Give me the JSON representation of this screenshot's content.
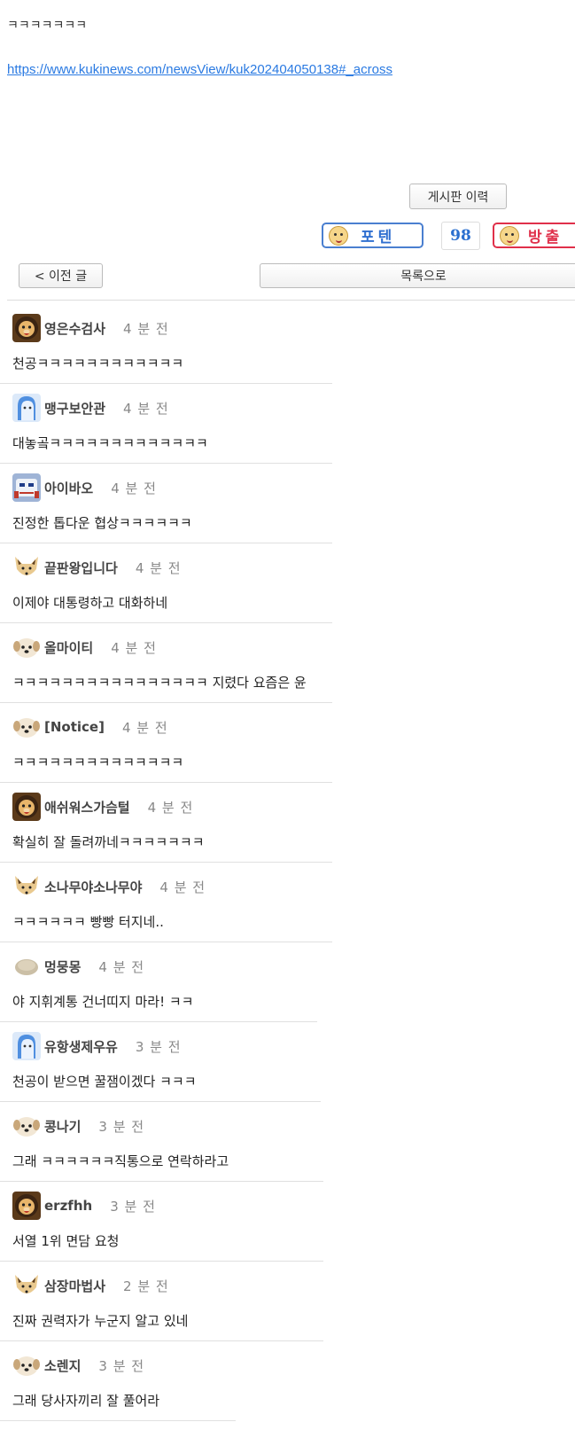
{
  "post": {
    "text": "ㅋㅋㅋㅋㅋㅋㅋ",
    "link": "https://www.kukinews.com/newsView/kuk202404050138#_across"
  },
  "actions": {
    "history_label": "게시판 이력",
    "upvote_label": "포텐",
    "vote_count": "98",
    "downvote_label": "방출",
    "prev_label": "< 이전 글",
    "list_label": "목록으로"
  },
  "comments": [
    {
      "nick": "영은수검사",
      "time": "4 분 전",
      "text": "천공ㅋㅋㅋㅋㅋㅋㅋㅋㅋㅋㅋㅋ",
      "avatar": "lion-avatar"
    },
    {
      "nick": "맹구보안관",
      "time": "4 분 전",
      "text": "대놓곸ㅋㅋㅋㅋㅋㅋㅋㅋㅋㅋㅋㅋㅋ",
      "avatar": "ghost-avatar"
    },
    {
      "nick": "아이바오",
      "time": "4 분 전",
      "text": "진정한 톱다운 협상ㅋㅋㅋㅋㅋㅋ",
      "avatar": "robot-avatar"
    },
    {
      "nick": "끝판왕입니다",
      "time": "4 분 전",
      "text": "이제야 대통령하고 대화하네",
      "avatar": "fox-avatar"
    },
    {
      "nick": "올마이티",
      "time": "4 분 전",
      "text": "ㅋㅋㅋㅋㅋㅋㅋㅋㅋㅋㅋㅋㅋㅋㅋㅋ 지렸다 요즘은 윤",
      "avatar": "puppy-avatar"
    },
    {
      "nick": "[Notice]",
      "time": "4 분 전",
      "text": "ㅋㅋㅋㅋㅋㅋㅋㅋㅋㅋㅋㅋㅋㅋ",
      "avatar": "puppy-avatar"
    },
    {
      "nick": "애쉬워스가슴털",
      "time": "4 분 전",
      "text": "확실히 잘 돌려까네ㅋㅋㅋㅋㅋㅋㅋ",
      "avatar": "lion-avatar"
    },
    {
      "nick": "소나무야소나무야",
      "time": "4 분 전",
      "text": "ㅋㅋㅋㅋㅋㅋ 빵빵 터지네..",
      "avatar": "fox-avatar"
    },
    {
      "nick": "멍뭉몽",
      "time": "4 분 전",
      "text": "야 지휘계통 건너띠지 마라! ㅋㅋ",
      "avatar": "egg-avatar"
    },
    {
      "nick": "유항생제우유",
      "time": "3 분 전",
      "text": "천공이 받으면 꿀잼이겠다 ㅋㅋㅋ",
      "avatar": "ghost-avatar"
    },
    {
      "nick": "콩나기",
      "time": "3 분 전",
      "text": "그래 ㅋㅋㅋㅋㅋㅋ직통으로 연락하라고",
      "avatar": "puppy-avatar"
    },
    {
      "nick": "erzfhh",
      "time": "3 분 전",
      "text": "서열 1위 면담 요청",
      "avatar": "lion-avatar"
    },
    {
      "nick": "삼장마법사",
      "time": "2 분 전",
      "text": "진짜 권력자가 누군지 알고 있네",
      "avatar": "fox-avatar"
    },
    {
      "nick": "소렌지",
      "time": "3 분 전",
      "text": "그래 당사자끼리 잘 풀어라",
      "avatar": "puppy-avatar"
    }
  ]
}
